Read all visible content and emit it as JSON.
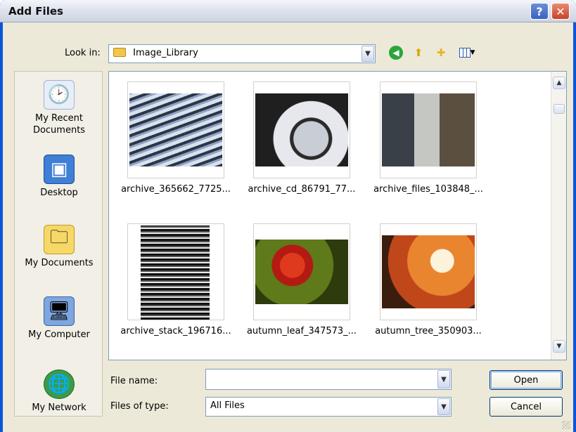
{
  "window": {
    "title": "Add Files",
    "help_glyph": "?",
    "close_glyph": "✕"
  },
  "toolbar": {
    "look_in_label": "Look in:",
    "look_in_value": "Image_Library",
    "icons": [
      "back-icon",
      "up-folder-icon",
      "new-folder-icon",
      "views-icon"
    ]
  },
  "places": [
    {
      "label": "My Recent Documents",
      "icon": "recent-documents-icon"
    },
    {
      "label": "Desktop",
      "icon": "desktop-icon"
    },
    {
      "label": "My Documents",
      "icon": "my-documents-icon"
    },
    {
      "label": "My Computer",
      "icon": "my-computer-icon"
    },
    {
      "label": "My Network",
      "icon": "my-network-icon"
    }
  ],
  "files": [
    {
      "name": "archive_365662_7725..."
    },
    {
      "name": "archive_cd_86791_77..."
    },
    {
      "name": "archive_files_103848_..."
    },
    {
      "name": "archive_stack_196716..."
    },
    {
      "name": "autumn_leaf_347573_..."
    },
    {
      "name": "autumn_tree_350903..."
    }
  ],
  "form": {
    "file_name_label": "File name:",
    "file_name_value": "",
    "file_type_label": "Files of type:",
    "file_type_value": "All Files"
  },
  "buttons": {
    "open": "Open",
    "cancel": "Cancel"
  },
  "colors": {
    "titlebar_top": "#f4f6fb",
    "dialog_bg": "#ece9d8",
    "close_red": "#c7432a",
    "border_blue": "#7f9db9"
  }
}
